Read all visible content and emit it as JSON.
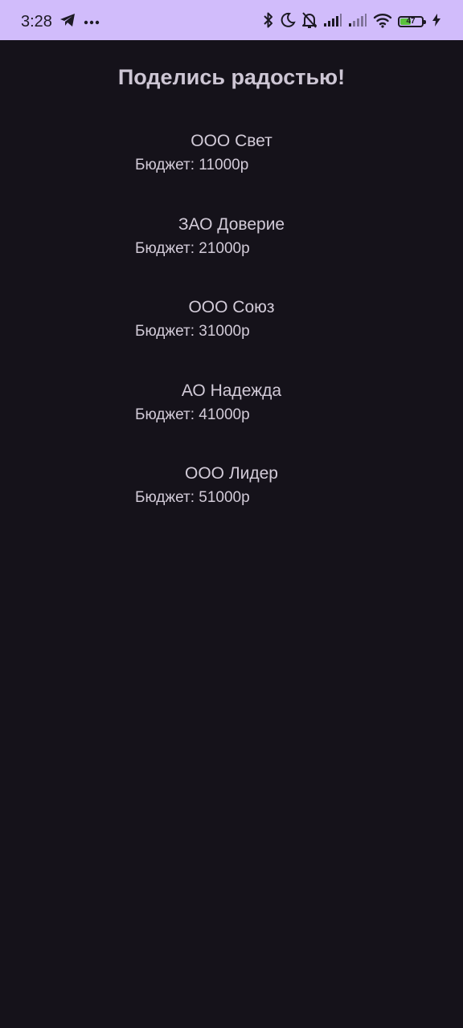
{
  "status_bar": {
    "time": "3:28",
    "battery_level": "47",
    "icons": {
      "left": [
        "telegram-icon",
        "more-dots-icon"
      ],
      "right": [
        "bluetooth-icon",
        "moon-icon",
        "bell-off-icon",
        "signal-icon",
        "signal-icon",
        "wifi-icon",
        "battery-icon",
        "charging-bolt-icon"
      ]
    }
  },
  "page": {
    "title": "Поделись радостью!"
  },
  "companies": [
    {
      "name": "ООО Свет",
      "budget": "Бюджет: 11000р"
    },
    {
      "name": "ЗАО Доверие",
      "budget": "Бюджет: 21000р"
    },
    {
      "name": "ООО Союз",
      "budget": "Бюджет: 31000р"
    },
    {
      "name": "АО Надежда",
      "budget": "Бюджет: 41000р"
    },
    {
      "name": "ООО Лидер",
      "budget": "Бюджет: 51000р"
    }
  ],
  "colors": {
    "status_bar_bg": "#d1bcfb",
    "background": "#15121a",
    "text": "#d2cbd8",
    "battery_fill": "#5ac23b"
  }
}
